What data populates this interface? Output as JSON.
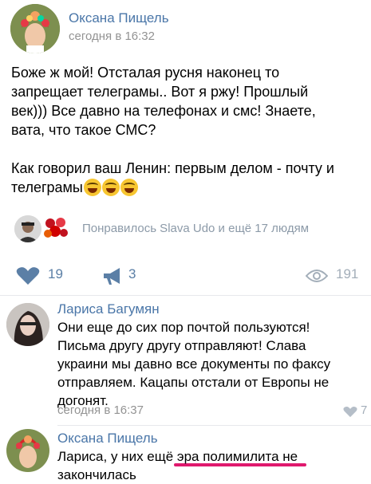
{
  "post": {
    "author": "Оксана Пищель",
    "time": "сегодня в 16:32",
    "text_lines": [
      "Боже ж мой! Отсталая русня наконец то",
      "запрещает телеграмы.. Вот я ржу! Прошлый",
      "век))) Все давно на телефонах и смс! Знаете,",
      "вата, что такое СМС?",
      "Как говорил ваш Ленин: первым делом - почту и",
      "телеграмы"
    ],
    "liked_text": "Понравилось Slava Udo и ещё 17 людям",
    "actions": {
      "likes": "19",
      "shares": "3",
      "views": "191"
    }
  },
  "comments": [
    {
      "author": "Лариса Багумян",
      "lines": [
        "Они еще до сих пор почтой пользуются!",
        "Письма другу другу отправляют! Слава",
        "украини мы давно все документы по факсу",
        "отправляем. Кацапы отстали от Европы не",
        "догонят."
      ],
      "time": "сегодня в 16:37",
      "likes": "7"
    },
    {
      "author": "Оксана Пищель",
      "lines": [
        "Лариса, у них ещё эра полимилита не",
        "закончилась"
      ]
    }
  ],
  "colors": {
    "link": "#4a76a8",
    "highlight": "#e0196e"
  }
}
